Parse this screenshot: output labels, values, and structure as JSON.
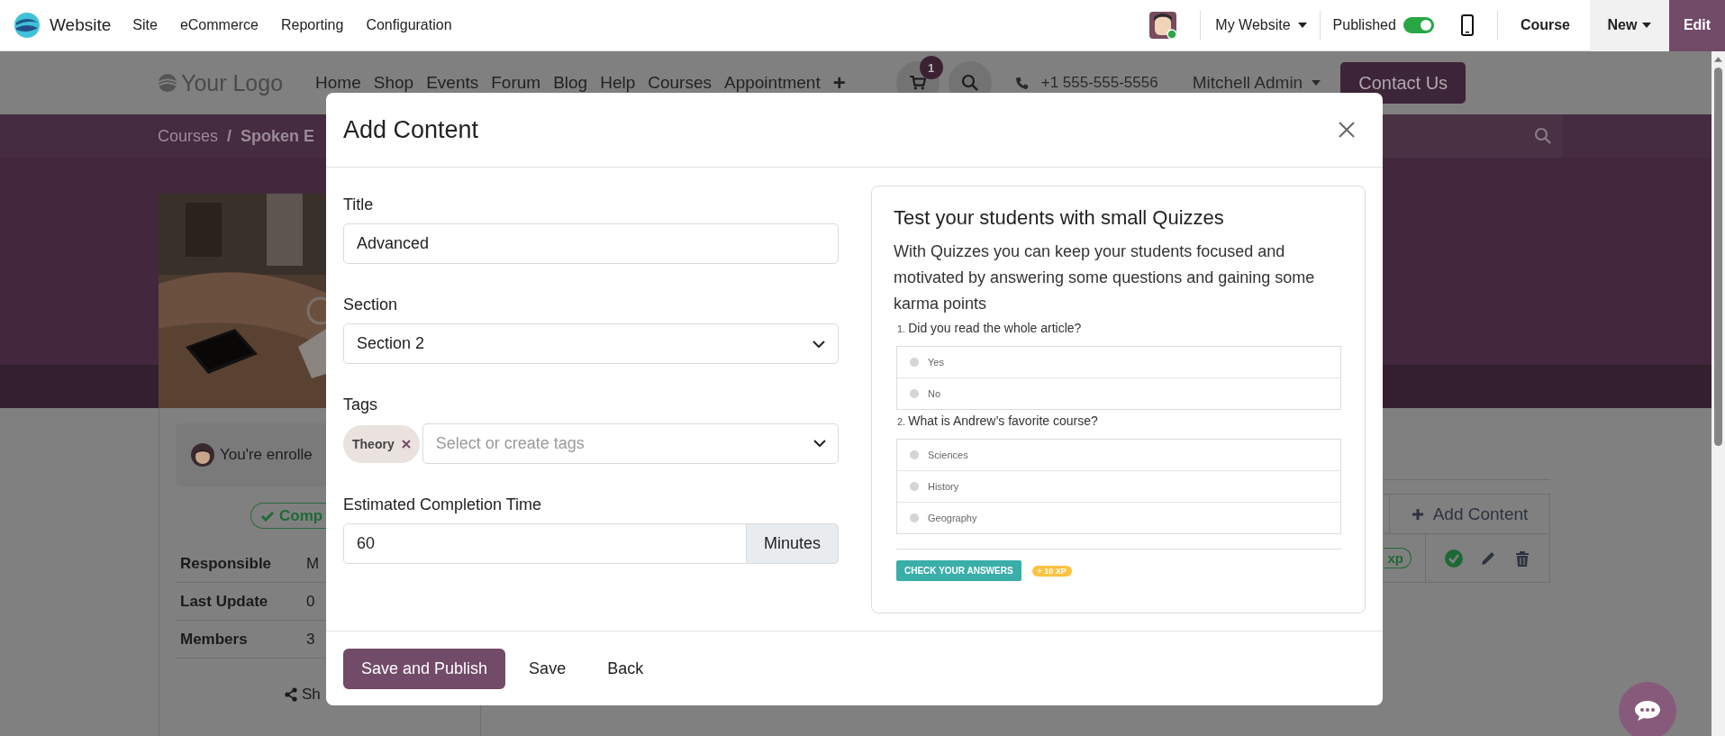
{
  "app_bar": {
    "app_name": "Website",
    "menu": [
      "Site",
      "eCommerce",
      "Reporting",
      "Configuration"
    ],
    "website_selector": "My Website",
    "published": {
      "label": "Published",
      "on": true
    },
    "course_link": "Course",
    "new_button": "New",
    "edit_button": "Edit"
  },
  "site_header": {
    "logo": "Your Logo",
    "nav": [
      "Home",
      "Shop",
      "Events",
      "Forum",
      "Blog",
      "Help",
      "Courses",
      "Appointment"
    ],
    "add_symbol": "+",
    "cart_count": "1",
    "phone": "+1 555-555-5556",
    "user": "Mitchell Admin",
    "cta": "Contact Us"
  },
  "breadcrumb": {
    "items": [
      "Courses",
      "Spoken E"
    ],
    "separator": "/"
  },
  "course_sidebar": {
    "enrollment": "You're enrolle",
    "status_badge": "Comp",
    "details": [
      {
        "label": "Responsible",
        "value": "M"
      },
      {
        "label": "Last Update",
        "value": "0"
      },
      {
        "label": "Members",
        "value": "3"
      }
    ],
    "share": "Sh"
  },
  "content_panel": {
    "add_button": "Add Content",
    "xp_badge": "xp"
  },
  "dialog": {
    "title": "Add Content",
    "fields": [
      {
        "kind": "text",
        "label": "Title",
        "value": "Advanced"
      },
      {
        "kind": "select",
        "label": "Section",
        "value": "Section 2"
      },
      {
        "kind": "tags",
        "label": "Tags",
        "tags": [
          "Theory"
        ],
        "placeholder": "Select or create tags"
      },
      {
        "kind": "number",
        "label": "Estimated Completion Time",
        "value": "60",
        "unit": "Minutes"
      }
    ],
    "preview": {
      "title": "Test your students with small Quizzes",
      "text": "With Quizzes you can keep your students focused and motivated by answering some questions and gaining some karma points",
      "questions": [
        {
          "number": "1.",
          "text": "Did you read the whole article?",
          "answers": [
            "Yes",
            "No"
          ]
        },
        {
          "number": "2.",
          "text": "What is Andrew’s favorite course?",
          "answers": [
            "Sciences",
            "History",
            "Geography"
          ]
        }
      ],
      "check_button": "CHECK YOUR ANSWERS",
      "xp_badge": "+ 10 XP"
    },
    "buttons": [
      {
        "kind": "primary",
        "label": "Save and Publish"
      },
      {
        "kind": "link",
        "label": "Save"
      },
      {
        "kind": "link",
        "label": "Back"
      }
    ]
  }
}
